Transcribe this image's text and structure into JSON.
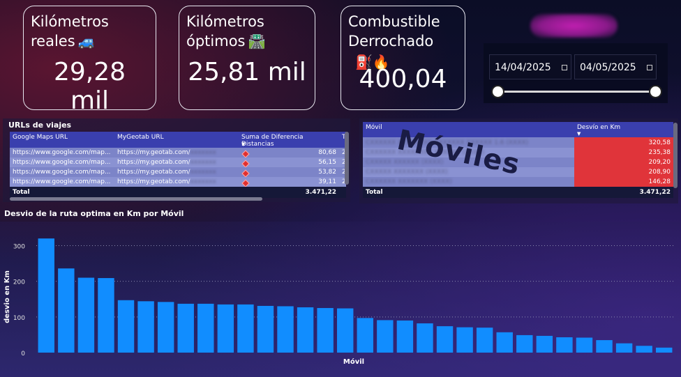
{
  "kpis": [
    {
      "title_line1": "Kilómetros",
      "title_line2": "reales",
      "emoji": "🚙",
      "value": "29,28 mil"
    },
    {
      "title_line1": "Kilómetros",
      "title_line2": "óptimos",
      "emoji": "🛣️",
      "value": "25,81 mil"
    },
    {
      "title_line1": "Combustible",
      "title_line2": "Derrochado",
      "emoji": "⛽🔥",
      "value": "400,04"
    }
  ],
  "date_slicer": {
    "start": "14/04/2025",
    "end": "04/05/2025"
  },
  "urls_table": {
    "title": "URLs de viajes",
    "columns": [
      "Google Maps URL",
      "MyGeotab URL",
      "Suma de Diferencia Distancias",
      "T"
    ],
    "rows": [
      {
        "gmaps": "https://www.google.com/map...",
        "geotab": "https://my.geotab.com/",
        "diff": "80,68",
        "t": "2"
      },
      {
        "gmaps": "https://www.google.com/map...",
        "geotab": "https://my.geotab.com/",
        "diff": "56,15",
        "t": "2"
      },
      {
        "gmaps": "https://www.google.com/map...",
        "geotab": "https://my.geotab.com/",
        "diff": "53,82",
        "t": "2"
      },
      {
        "gmaps": "https://www.google.com/map...",
        "geotab": "https://my.geotab.com/",
        "diff": "39,11",
        "t": "2"
      }
    ],
    "total_label": "Total",
    "total_value": "3.471,22"
  },
  "moviles_table": {
    "columns": [
      "Móvil",
      "Desvío en Km"
    ],
    "watermark": "Móviles",
    "rows": [
      "320,58",
      "235,38",
      "209,20",
      "208,90",
      "146,28"
    ],
    "total_label": "Total",
    "total_value": "3.471,22"
  },
  "chart_title": "Desvio de la ruta optima en Km por Móvil",
  "chart_data": {
    "type": "bar",
    "xlabel": "Móvil",
    "ylabel": "desvio en Km",
    "ylim": [
      0,
      340
    ],
    "yticks": [
      0,
      100,
      200,
      300
    ],
    "values": [
      320,
      236,
      210,
      209,
      147,
      144,
      142,
      137,
      137,
      135,
      135,
      131,
      130,
      127,
      125,
      124,
      97,
      91,
      90,
      82,
      74,
      71,
      70,
      57,
      49,
      47,
      43,
      42,
      35,
      26,
      19,
      14
    ],
    "color": "#118dff"
  }
}
